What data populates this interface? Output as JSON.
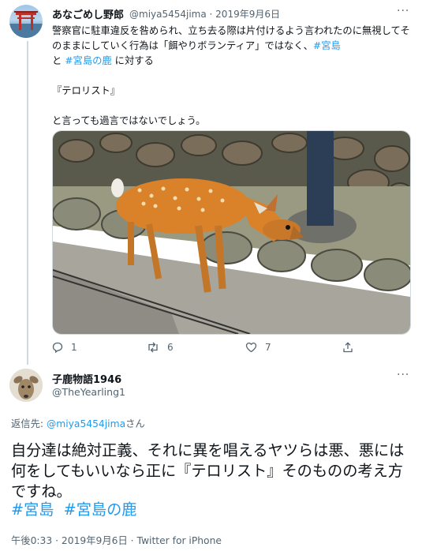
{
  "tweet1": {
    "display_name": "あなごめし野郎",
    "handle_date": "@miya5454jima · 2019年9月6日",
    "more": "···",
    "text_main": "警察官に駐車違反を咎められ、立ち去る際は片付けるよう言われたのに無視してそのままにしていく行為は「餌やりボランティア」ではなく、",
    "tag1": "#宮島",
    "text_and": "と",
    "tag2": "#宮島の鹿",
    "text_after": "に対する",
    "text_quote": "『テロリスト』",
    "text_end": "と言っても過言ではないでしょう。",
    "photo_icon": "deer-photo",
    "actions": {
      "reply_count": "1",
      "retweet_count": "6",
      "like_count": "7"
    }
  },
  "tweet2": {
    "display_name": "子鹿物語1946",
    "handle": "@TheYearling1",
    "more": "···",
    "reply_prefix": "返信先: ",
    "reply_handle": "@miya5454jima",
    "reply_suffix": "さん",
    "text": "自分達は絶対正義、それに異を唱えるヤツらは悪、悪には何をしてもいいなら正に『テロリスト』そのものの考え方ですね。",
    "tag1": "#宮島",
    "tag2": "#宮島の鹿",
    "meta": "午後0:33 · 2019年9月6日 · Twitter for iPhone"
  },
  "colors": {
    "link": "#1d9bf0",
    "secondary": "#536471",
    "text": "#0f1419"
  }
}
